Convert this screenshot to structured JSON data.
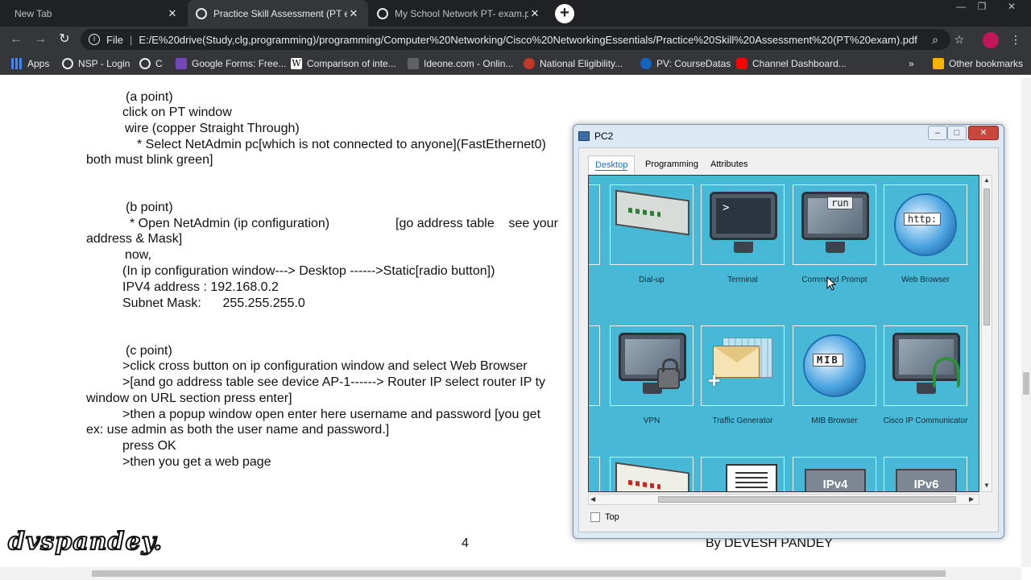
{
  "browser": {
    "tabs": [
      {
        "title": "New Tab",
        "active": false
      },
      {
        "title": "Practice Skill Assessment (PT exa",
        "active": true
      },
      {
        "title": "My School Network PT- exam.pd",
        "active": false
      }
    ],
    "url_prefix": "File",
    "url": "E:/E%20drive(Study,clg,programming)/programming/Computer%20Networking/Cisco%20NetworkingEssentials/Practice%20Skill%20Assessment%20(PT%20exam).pdf",
    "bookmarks": [
      {
        "label": "Apps",
        "icon": "apps-grid-icon",
        "color": "#e8eaed"
      },
      {
        "label": "NSP - Login",
        "icon": "globe-icon",
        "color": "#e8eaed"
      },
      {
        "label": "C",
        "icon": "globe-icon",
        "color": "#e8eaed"
      },
      {
        "label": "Google Forms: Free...",
        "icon": "google-forms-icon",
        "color": "#7248b9"
      },
      {
        "label": "Comparison of inte...",
        "icon": "wikipedia-icon",
        "color": "#e8eaed"
      },
      {
        "label": "Ideone.com - Onlin...",
        "icon": "ideone-icon",
        "color": "#5f6368"
      },
      {
        "label": "National Eligibility...",
        "icon": "nta-icon",
        "color": "#c0392b"
      },
      {
        "label": "PV: CourseDatas",
        "icon": "pv-icon",
        "color": "#1565c0"
      },
      {
        "label": "Channel Dashboard...",
        "icon": "youtube-icon",
        "color": "#ff0000"
      }
    ],
    "other_bookmarks": "Other bookmarks"
  },
  "document": {
    "lines": [
      "(a point)",
      "click on PT window",
      "wire (copper Straight Through)",
      "* Select NetAdmin pc[which is not connected to anyone](FastEthernet0)",
      "both must blink green]",
      "(b point)",
      "* Open NetAdmin (ip configuration)",
      "[go address table    see your",
      "address & Mask]",
      "now,",
      "(In ip configuration window---> Desktop ------>Static[radio button])",
      "IPV4 address : 192.168.0.2",
      "Subnet Mask:      255.255.255.0",
      "(c point)",
      ">click cross button on ip configuration window and select Web Browser",
      ">[and go address table see device AP-1------> Router IP select router IP ty",
      "window on URL section press enter]",
      ">then a popup window open enter here username and password [you get",
      "ex: use admin as both the user name and password.]",
      "press OK",
      ">then you get a web page"
    ],
    "page_number": "4",
    "author": "By DEVESH PANDEY",
    "watermark": "dvspandey."
  },
  "pt_window": {
    "title": "PC2",
    "tabs": [
      "Desktop",
      "Programming",
      "Attributes"
    ],
    "active_tab": "Desktop",
    "apps": [
      {
        "label": "Dial-up",
        "icon": "modem-icon"
      },
      {
        "label": "Terminal",
        "icon": "terminal-icon",
        "glyph": ">"
      },
      {
        "label": "Command Prompt",
        "icon": "command-prompt-icon",
        "glyph": "run"
      },
      {
        "label": "Web Browser",
        "icon": "web-browser-icon",
        "glyph": "http:"
      },
      {
        "label": "VPN",
        "icon": "vpn-lock-icon"
      },
      {
        "label": "Traffic Generator",
        "icon": "traffic-generator-icon"
      },
      {
        "label": "MIB Browser",
        "icon": "mib-browser-icon",
        "glyph": "MIB"
      },
      {
        "label": "Cisco IP Communicator",
        "icon": "ip-communicator-icon"
      },
      {
        "label": "",
        "icon": "modem-icon"
      },
      {
        "label": "",
        "icon": "text-editor-icon"
      },
      {
        "label": "",
        "icon": "ipv4-icon",
        "glyph": "IPv4"
      },
      {
        "label": "",
        "icon": "ipv6-icon",
        "glyph": "IPv6"
      }
    ],
    "top_checkbox": "Top"
  },
  "colors": {
    "browser_bg": "#202124",
    "toolbar_bg": "#35363a",
    "desktop_bg": "#47b9d6",
    "tab_active_text": "#1a73c9"
  }
}
